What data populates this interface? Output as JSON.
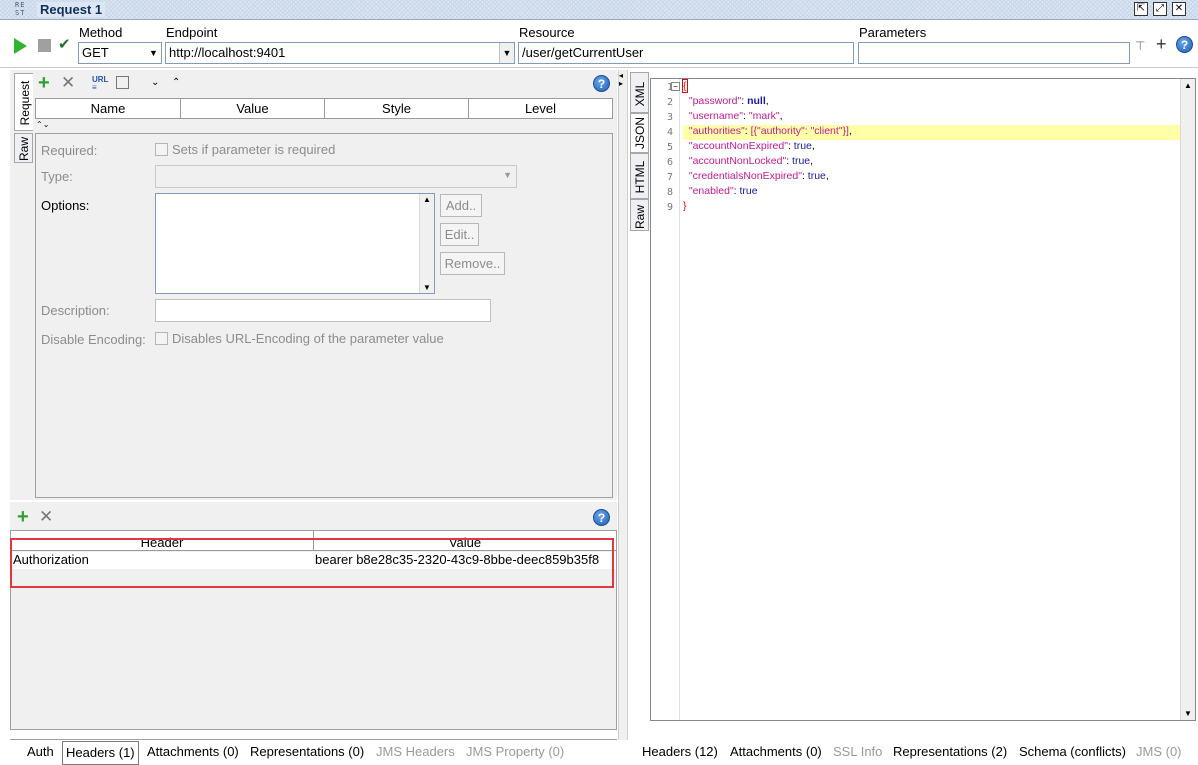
{
  "window": {
    "logo_text": "RE ST",
    "title": "Request 1",
    "icons": [
      "detach-icon",
      "maximize-icon",
      "close-icon"
    ]
  },
  "toolbar": {
    "method_label": "Method",
    "method_value": "GET",
    "endpoint_label": "Endpoint",
    "endpoint_value": "http://localhost:9401",
    "resource_label": "Resource",
    "resource_value": "/user/getCurrentUser",
    "parameters_label": "Parameters",
    "parameters_value": ""
  },
  "request_tabs": [
    "Request",
    "Raw"
  ],
  "params_table": {
    "columns": [
      "Name",
      "Value",
      "Style",
      "Level"
    ]
  },
  "param_form": {
    "required_label": "Required:",
    "required_check": "Sets if parameter is required",
    "type_label": "Type:",
    "options_label": "Options:",
    "add_label": "Add..",
    "edit_label": "Edit..",
    "remove_label": "Remove..",
    "description_label": "Description:",
    "disable_encoding_label": "Disable Encoding:",
    "disable_encoding_check": "Disables URL-Encoding of the parameter value"
  },
  "headers_table": {
    "columns": [
      "Header",
      "Value"
    ],
    "rows": [
      {
        "header": "Authorization",
        "value": "bearer b8e28c35-2320-43c9-8bbe-deec859b35f8"
      }
    ]
  },
  "request_bottom_tabs": [
    {
      "label": "Auth",
      "state": "normal"
    },
    {
      "label": "Headers (1)",
      "state": "selected"
    },
    {
      "label": "Attachments (0)",
      "state": "normal"
    },
    {
      "label": "Representations (0)",
      "state": "normal"
    },
    {
      "label": "JMS Headers",
      "state": "disabled"
    },
    {
      "label": "JMS Property (0)",
      "state": "disabled"
    }
  ],
  "response_tabs": [
    "XML",
    "JSON",
    "HTML",
    "Raw"
  ],
  "response_json": {
    "line_numbers": [
      "1",
      "2",
      "3",
      "4",
      "5",
      "6",
      "7",
      "8",
      "9"
    ],
    "lines": [
      {
        "key": "",
        "value": "{"
      },
      {
        "key": "\"password\"",
        "value": "null"
      },
      {
        "key": "\"username\"",
        "value": "\"mark\""
      },
      {
        "key": "\"authorities\"",
        "value": "[{\"authority\": \"client\"}]"
      },
      {
        "key": "\"accountNonExpired\"",
        "value": "true"
      },
      {
        "key": "\"accountNonLocked\"",
        "value": "true"
      },
      {
        "key": "\"credentialsNonExpired\"",
        "value": "true"
      },
      {
        "key": "\"enabled\"",
        "value": "true"
      },
      {
        "key": "",
        "value": "}"
      }
    ],
    "highlighted_line": 4
  },
  "response_bottom_tabs": [
    {
      "label": "Headers (12)",
      "state": "normal"
    },
    {
      "label": "Attachments (0)",
      "state": "normal"
    },
    {
      "label": "SSL Info",
      "state": "disabled"
    },
    {
      "label": "Representations (2)",
      "state": "normal"
    },
    {
      "label": "Schema (conflicts)",
      "state": "normal"
    },
    {
      "label": "JMS (0)",
      "state": "disabled"
    }
  ],
  "colors": {
    "highlight_box": "#e0383e",
    "highlight_line": "#ffffa8",
    "run_green": "#2fb52f",
    "json_key": "#c01b8f",
    "json_value": "#1a1a9c"
  }
}
